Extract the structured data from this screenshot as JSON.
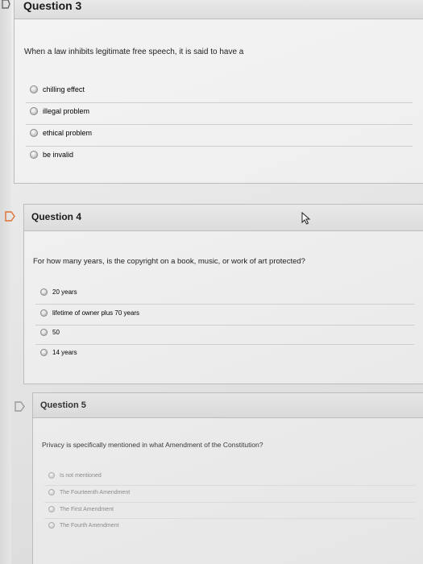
{
  "questions": [
    {
      "title": "Question 3",
      "prompt": "When a law inhibits legitimate free speech, it is said to have a",
      "options": [
        "chilling effect",
        "illegal problem",
        "ethical problem",
        "be invalid"
      ]
    },
    {
      "title": "Question 4",
      "prompt": "For how many years, is the copyright on a book, music, or work of art protected?",
      "options": [
        "20 years",
        "lifetime of owner plus 70 years",
        "50",
        "14 years"
      ]
    },
    {
      "title": "Question 5",
      "prompt": "Privacy is specifically mentioned in what Amendment of the Constitution?",
      "options": [
        "Is not mentioned",
        "The Fourteenth Amendment",
        "The First Amendment",
        "The Fourth Amendment"
      ]
    }
  ],
  "colors": {
    "text": "#1a1a1a",
    "flag_outline": "#e07030"
  },
  "icons": {
    "flag": "flag-icon",
    "cursor": "mouse-cursor-icon"
  }
}
